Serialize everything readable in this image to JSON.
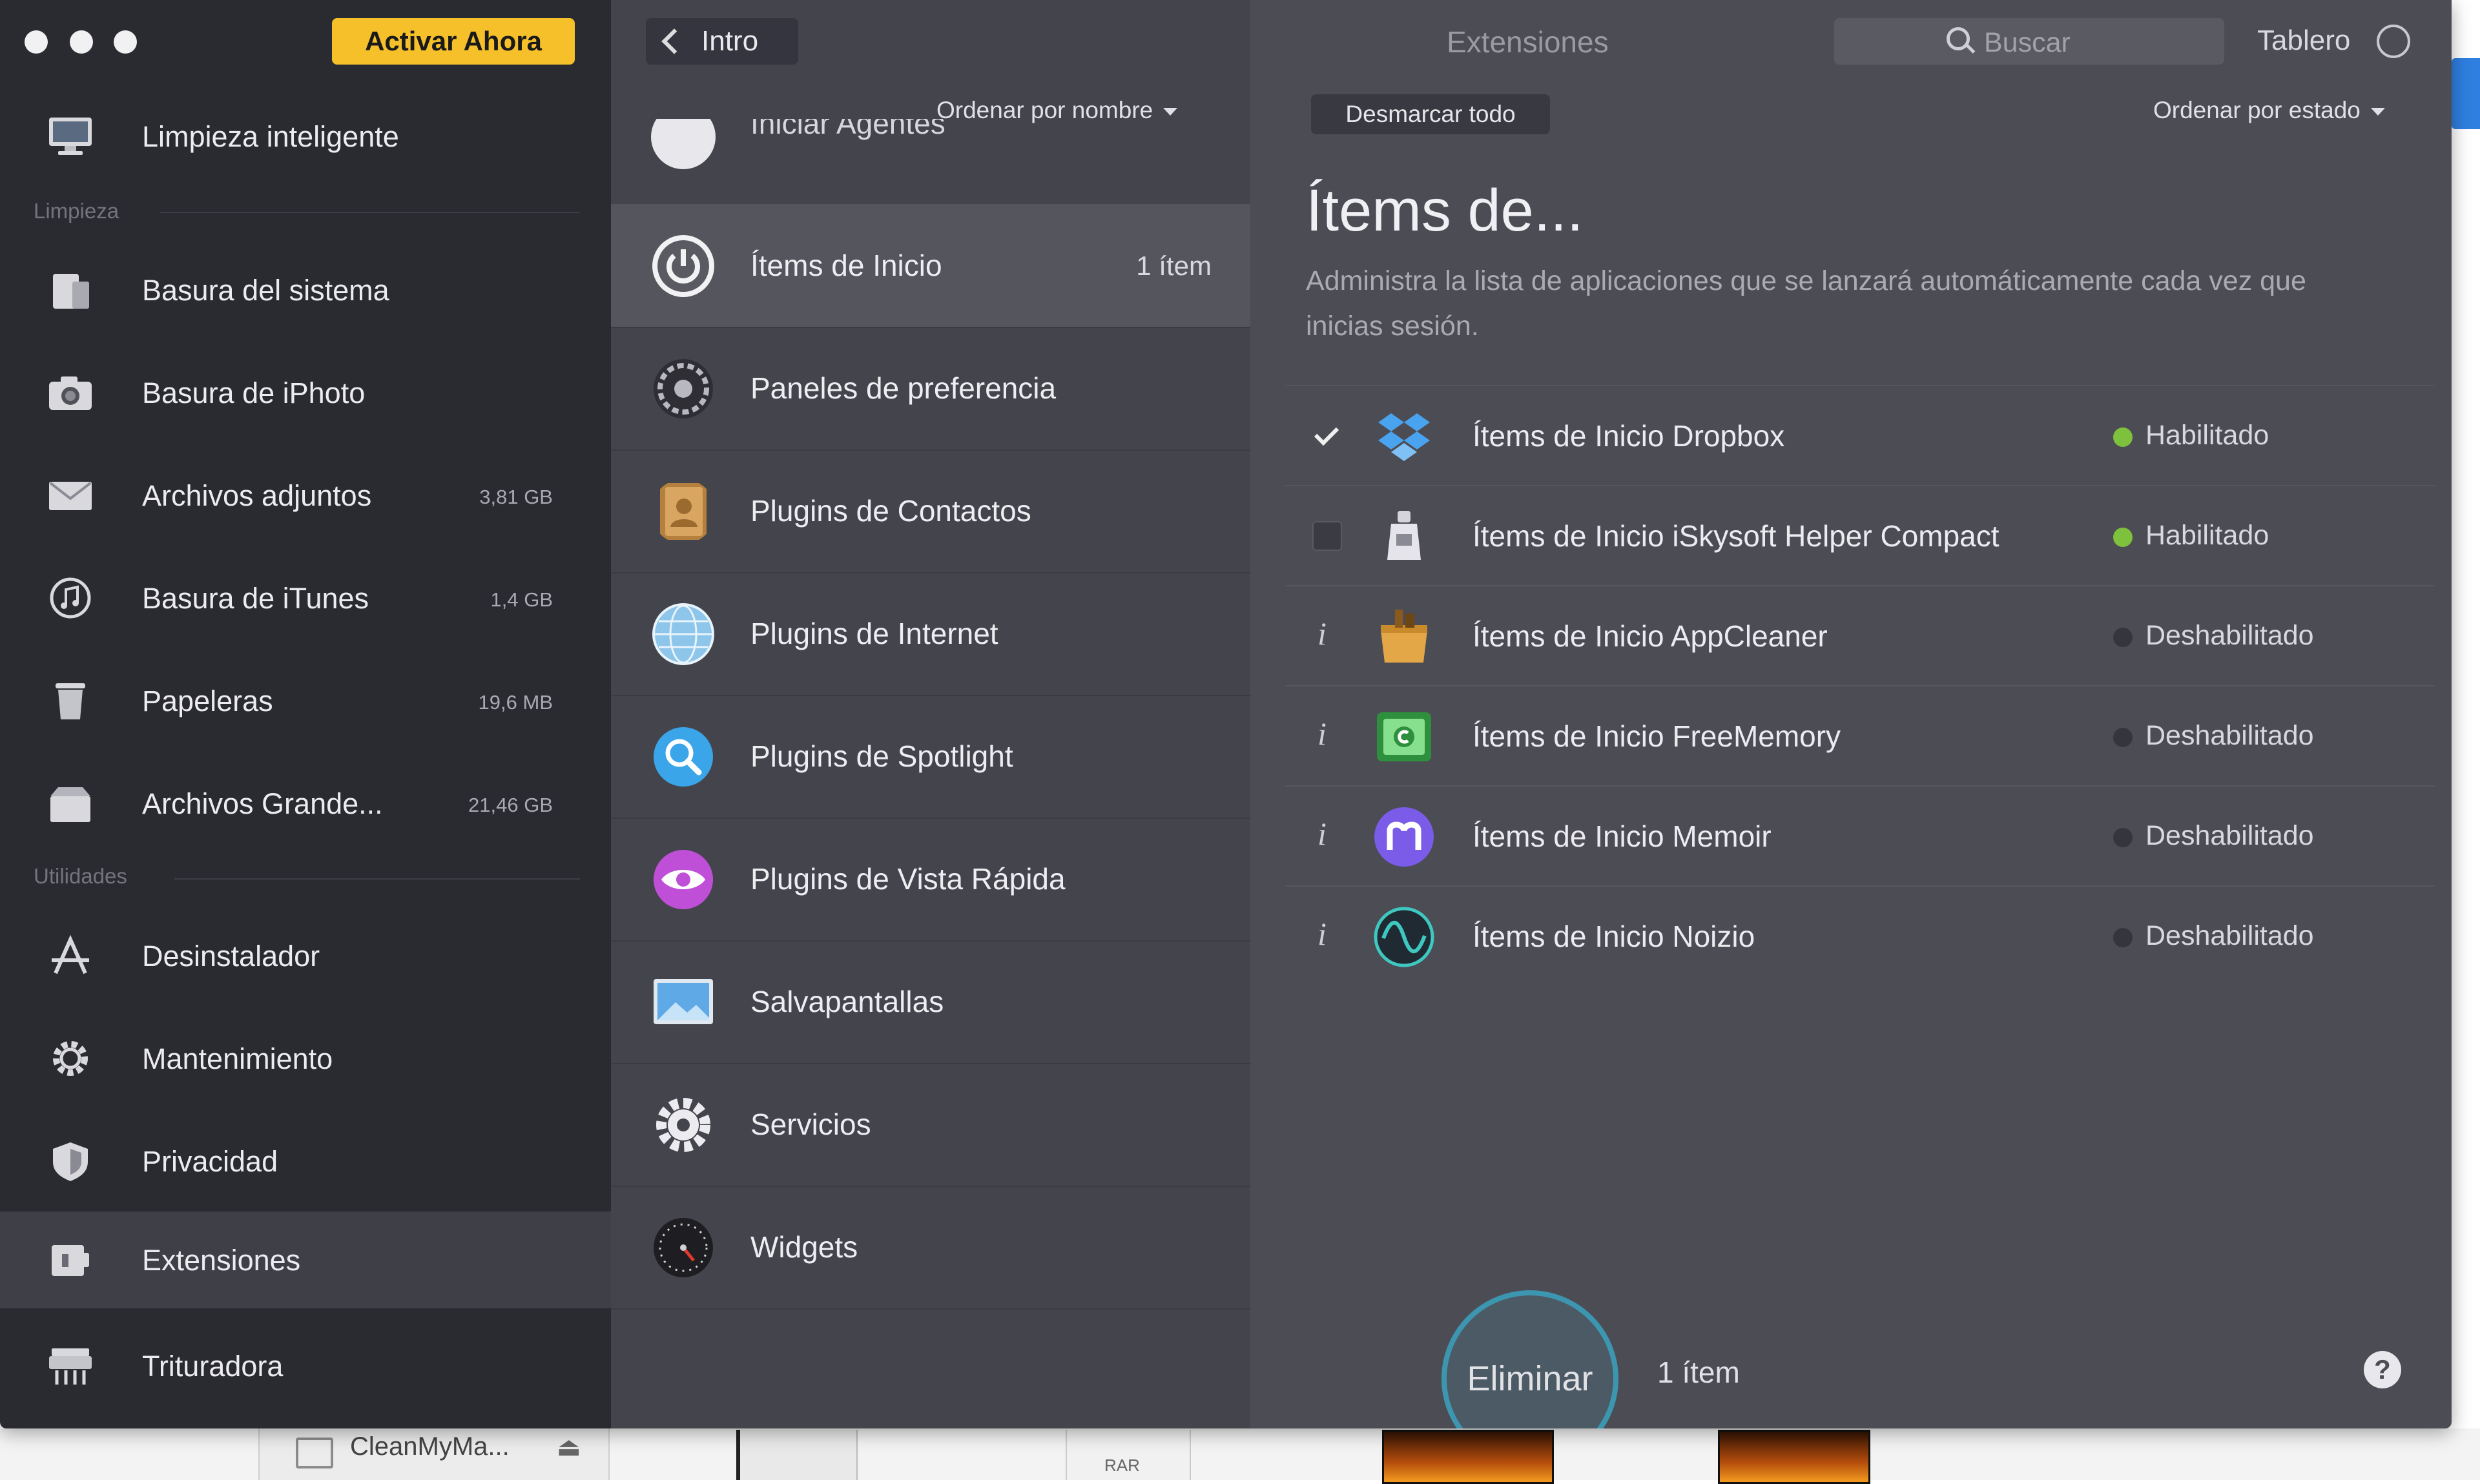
{
  "app": {
    "activate_label": "Activar Ahora",
    "pane_title": "Extensiones",
    "back_label": "Intro",
    "search_placeholder": "Buscar",
    "dashboard_label": "Tablero"
  },
  "sidebar": {
    "top_item": {
      "label": "Limpieza inteligente",
      "icon": "monitor-icon"
    },
    "sections": [
      {
        "title": "Limpieza"
      },
      {
        "title": "Utilidades"
      }
    ],
    "items": [
      {
        "label": "Basura del sistema",
        "size": "",
        "icon": "system-junk-icon"
      },
      {
        "label": "Basura de iPhoto",
        "size": "",
        "icon": "camera-icon"
      },
      {
        "label": "Archivos adjuntos",
        "size": "3,81 GB",
        "icon": "envelope-icon"
      },
      {
        "label": "Basura de iTunes",
        "size": "1,4 GB",
        "icon": "music-note-icon"
      },
      {
        "label": "Papeleras",
        "size": "19,6 MB",
        "icon": "trash-icon"
      },
      {
        "label": "Archivos Grande...",
        "size": "21,46 GB",
        "icon": "box-icon"
      },
      {
        "label": "Desinstalador",
        "size": "",
        "icon": "app-store-icon"
      },
      {
        "label": "Mantenimiento",
        "size": "",
        "icon": "gear-icon"
      },
      {
        "label": "Privacidad",
        "size": "",
        "icon": "shield-icon"
      },
      {
        "label": "Extensiones",
        "size": "",
        "icon": "extensions-icon",
        "selected": true
      },
      {
        "label": "Trituradora",
        "size": "",
        "icon": "shredder-icon"
      }
    ]
  },
  "middle": {
    "sort_label": "Ordenar por nombre",
    "partial_item": "Iniciar Agentes",
    "items": [
      {
        "label": "Ítems de Inicio",
        "count": "1 ítem",
        "icon": "power-icon",
        "selected": true
      },
      {
        "label": "Paneles de preferencia",
        "count": "",
        "icon": "preferences-icon"
      },
      {
        "label": "Plugins de Contactos",
        "count": "",
        "icon": "contacts-icon"
      },
      {
        "label": "Plugins de Internet",
        "count": "",
        "icon": "globe-icon"
      },
      {
        "label": "Plugins de Spotlight",
        "count": "",
        "icon": "spotlight-icon"
      },
      {
        "label": "Plugins de Vista Rápida",
        "count": "",
        "icon": "eye-icon"
      },
      {
        "label": "Salvapantallas",
        "count": "",
        "icon": "screensaver-icon"
      },
      {
        "label": "Servicios",
        "count": "",
        "icon": "gear-icon"
      },
      {
        "label": "Widgets",
        "count": "",
        "icon": "dashboard-icon"
      }
    ]
  },
  "detail": {
    "deselect_label": "Desmarcar todo",
    "sort_label": "Ordenar por estado",
    "title": "Ítems de...",
    "description": "Administra la lista de aplicaciones que se lanzará automáticamente cada vez que inicias sesión.",
    "rows": [
      {
        "label": "Ítems de Inicio Dropbox",
        "status": "Habilitado",
        "enabled": true,
        "control": "checked",
        "icon": "dropbox-icon"
      },
      {
        "label": "Ítems de Inicio iSkysoft Helper Compact",
        "status": "Habilitado",
        "enabled": true,
        "control": "unchecked",
        "icon": "helper-icon"
      },
      {
        "label": "Ítems de Inicio AppCleaner",
        "status": "Deshabilitado",
        "enabled": false,
        "control": "info",
        "icon": "appcleaner-icon"
      },
      {
        "label": "Ítems de Inicio FreeMemory",
        "status": "Deshabilitado",
        "enabled": false,
        "control": "info",
        "icon": "freememory-icon"
      },
      {
        "label": "Ítems de Inicio Memoir",
        "status": "Deshabilitado",
        "enabled": false,
        "control": "info",
        "icon": "memoir-icon"
      },
      {
        "label": "Ítems de Inicio Noizio",
        "status": "Deshabilitado",
        "enabled": false,
        "control": "info",
        "icon": "noizio-icon"
      }
    ]
  },
  "footer": {
    "delete_label": "Eliminar",
    "count": "1 ítem",
    "help_label": "?"
  },
  "desktop": {
    "finder_item": "CleanMyMa...",
    "eject_glyph": "⏏",
    "rar_label": "RAR"
  },
  "colors": {
    "accent": "#f5c02a",
    "enabled": "#7ec13d",
    "disabled": "#35353c",
    "delete_ring": "#3d96b0"
  }
}
